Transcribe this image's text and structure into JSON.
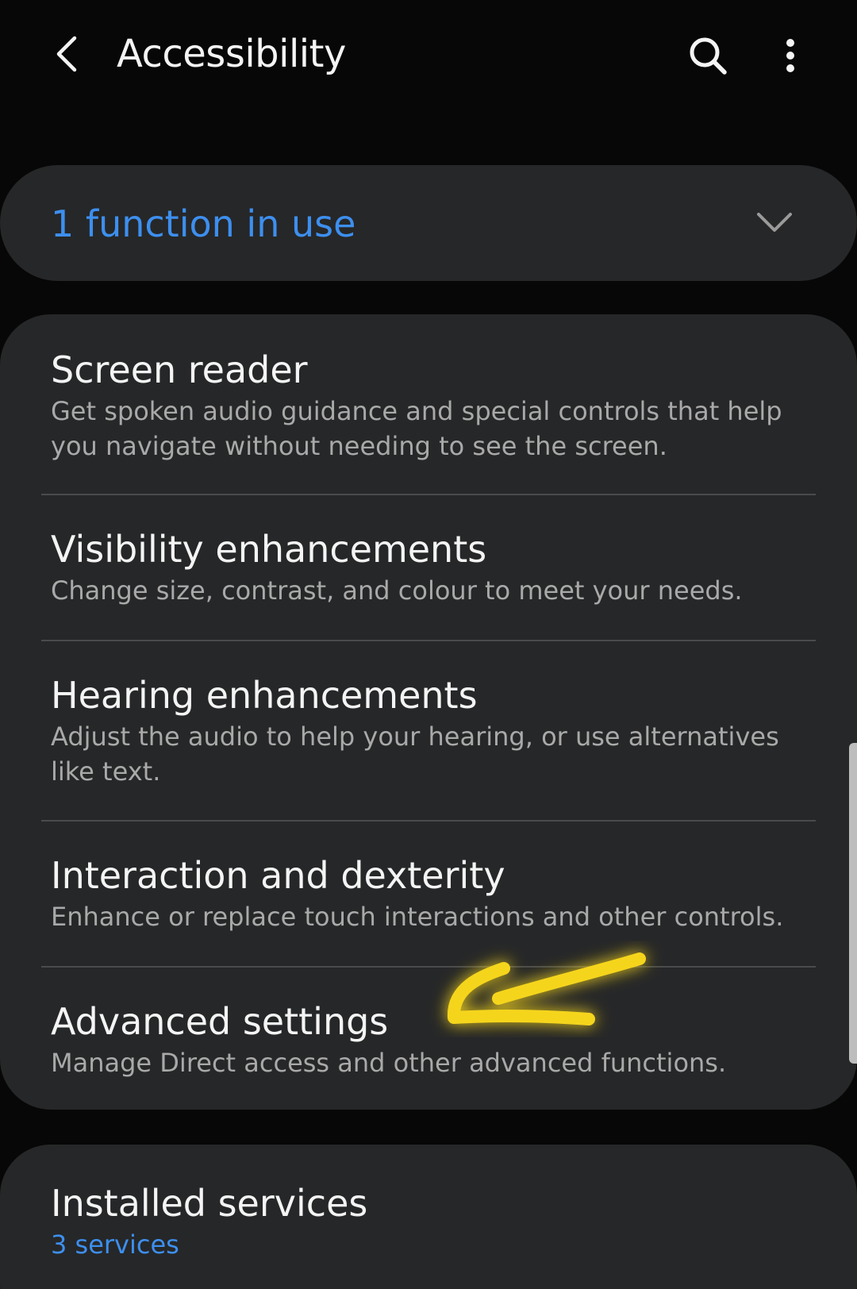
{
  "header": {
    "title": "Accessibility",
    "back_icon": "chevron-left-icon",
    "search_icon": "search-icon",
    "more_icon": "more-vertical-icon"
  },
  "functions": {
    "label": "1 function in use",
    "icon": "chevron-down-icon"
  },
  "items": [
    {
      "title": "Screen reader",
      "subtitle": "Get spoken audio guidance and special controls that help you navigate without needing to see the screen."
    },
    {
      "title": "Visibility enhancements",
      "subtitle": "Change size, contrast, and colour to meet your needs."
    },
    {
      "title": "Hearing enhancements",
      "subtitle": "Adjust the audio to help your hearing, or use alternatives like text."
    },
    {
      "title": "Interaction and dexterity",
      "subtitle": "Enhance or replace touch interactions and other controls."
    },
    {
      "title": "Advanced settings",
      "subtitle": "Manage Direct access and other advanced functions."
    }
  ],
  "installed_services": {
    "title": "Installed services",
    "subtitle": "3 services"
  },
  "colors": {
    "background": "#070707",
    "card": "#262728",
    "accent_blue": "#3d8fef",
    "highlighter": "#f5d51c"
  }
}
